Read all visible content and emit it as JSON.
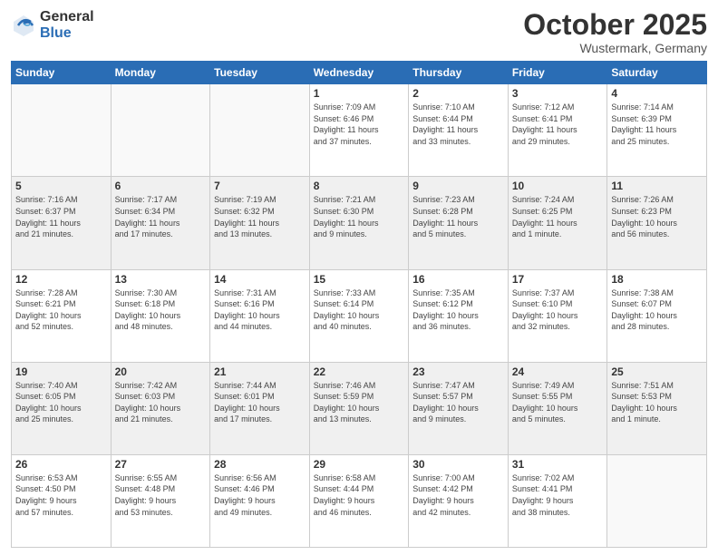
{
  "header": {
    "logo_general": "General",
    "logo_blue": "Blue",
    "month_title": "October 2025",
    "location": "Wustermark, Germany"
  },
  "days_of_week": [
    "Sunday",
    "Monday",
    "Tuesday",
    "Wednesday",
    "Thursday",
    "Friday",
    "Saturday"
  ],
  "weeks": [
    [
      {
        "day": "",
        "info": ""
      },
      {
        "day": "",
        "info": ""
      },
      {
        "day": "",
        "info": ""
      },
      {
        "day": "1",
        "info": "Sunrise: 7:09 AM\nSunset: 6:46 PM\nDaylight: 11 hours\nand 37 minutes."
      },
      {
        "day": "2",
        "info": "Sunrise: 7:10 AM\nSunset: 6:44 PM\nDaylight: 11 hours\nand 33 minutes."
      },
      {
        "day": "3",
        "info": "Sunrise: 7:12 AM\nSunset: 6:41 PM\nDaylight: 11 hours\nand 29 minutes."
      },
      {
        "day": "4",
        "info": "Sunrise: 7:14 AM\nSunset: 6:39 PM\nDaylight: 11 hours\nand 25 minutes."
      }
    ],
    [
      {
        "day": "5",
        "info": "Sunrise: 7:16 AM\nSunset: 6:37 PM\nDaylight: 11 hours\nand 21 minutes."
      },
      {
        "day": "6",
        "info": "Sunrise: 7:17 AM\nSunset: 6:34 PM\nDaylight: 11 hours\nand 17 minutes."
      },
      {
        "day": "7",
        "info": "Sunrise: 7:19 AM\nSunset: 6:32 PM\nDaylight: 11 hours\nand 13 minutes."
      },
      {
        "day": "8",
        "info": "Sunrise: 7:21 AM\nSunset: 6:30 PM\nDaylight: 11 hours\nand 9 minutes."
      },
      {
        "day": "9",
        "info": "Sunrise: 7:23 AM\nSunset: 6:28 PM\nDaylight: 11 hours\nand 5 minutes."
      },
      {
        "day": "10",
        "info": "Sunrise: 7:24 AM\nSunset: 6:25 PM\nDaylight: 11 hours\nand 1 minute."
      },
      {
        "day": "11",
        "info": "Sunrise: 7:26 AM\nSunset: 6:23 PM\nDaylight: 10 hours\nand 56 minutes."
      }
    ],
    [
      {
        "day": "12",
        "info": "Sunrise: 7:28 AM\nSunset: 6:21 PM\nDaylight: 10 hours\nand 52 minutes."
      },
      {
        "day": "13",
        "info": "Sunrise: 7:30 AM\nSunset: 6:18 PM\nDaylight: 10 hours\nand 48 minutes."
      },
      {
        "day": "14",
        "info": "Sunrise: 7:31 AM\nSunset: 6:16 PM\nDaylight: 10 hours\nand 44 minutes."
      },
      {
        "day": "15",
        "info": "Sunrise: 7:33 AM\nSunset: 6:14 PM\nDaylight: 10 hours\nand 40 minutes."
      },
      {
        "day": "16",
        "info": "Sunrise: 7:35 AM\nSunset: 6:12 PM\nDaylight: 10 hours\nand 36 minutes."
      },
      {
        "day": "17",
        "info": "Sunrise: 7:37 AM\nSunset: 6:10 PM\nDaylight: 10 hours\nand 32 minutes."
      },
      {
        "day": "18",
        "info": "Sunrise: 7:38 AM\nSunset: 6:07 PM\nDaylight: 10 hours\nand 28 minutes."
      }
    ],
    [
      {
        "day": "19",
        "info": "Sunrise: 7:40 AM\nSunset: 6:05 PM\nDaylight: 10 hours\nand 25 minutes."
      },
      {
        "day": "20",
        "info": "Sunrise: 7:42 AM\nSunset: 6:03 PM\nDaylight: 10 hours\nand 21 minutes."
      },
      {
        "day": "21",
        "info": "Sunrise: 7:44 AM\nSunset: 6:01 PM\nDaylight: 10 hours\nand 17 minutes."
      },
      {
        "day": "22",
        "info": "Sunrise: 7:46 AM\nSunset: 5:59 PM\nDaylight: 10 hours\nand 13 minutes."
      },
      {
        "day": "23",
        "info": "Sunrise: 7:47 AM\nSunset: 5:57 PM\nDaylight: 10 hours\nand 9 minutes."
      },
      {
        "day": "24",
        "info": "Sunrise: 7:49 AM\nSunset: 5:55 PM\nDaylight: 10 hours\nand 5 minutes."
      },
      {
        "day": "25",
        "info": "Sunrise: 7:51 AM\nSunset: 5:53 PM\nDaylight: 10 hours\nand 1 minute."
      }
    ],
    [
      {
        "day": "26",
        "info": "Sunrise: 6:53 AM\nSunset: 4:50 PM\nDaylight: 9 hours\nand 57 minutes."
      },
      {
        "day": "27",
        "info": "Sunrise: 6:55 AM\nSunset: 4:48 PM\nDaylight: 9 hours\nand 53 minutes."
      },
      {
        "day": "28",
        "info": "Sunrise: 6:56 AM\nSunset: 4:46 PM\nDaylight: 9 hours\nand 49 minutes."
      },
      {
        "day": "29",
        "info": "Sunrise: 6:58 AM\nSunset: 4:44 PM\nDaylight: 9 hours\nand 46 minutes."
      },
      {
        "day": "30",
        "info": "Sunrise: 7:00 AM\nSunset: 4:42 PM\nDaylight: 9 hours\nand 42 minutes."
      },
      {
        "day": "31",
        "info": "Sunrise: 7:02 AM\nSunset: 4:41 PM\nDaylight: 9 hours\nand 38 minutes."
      },
      {
        "day": "",
        "info": ""
      }
    ]
  ]
}
